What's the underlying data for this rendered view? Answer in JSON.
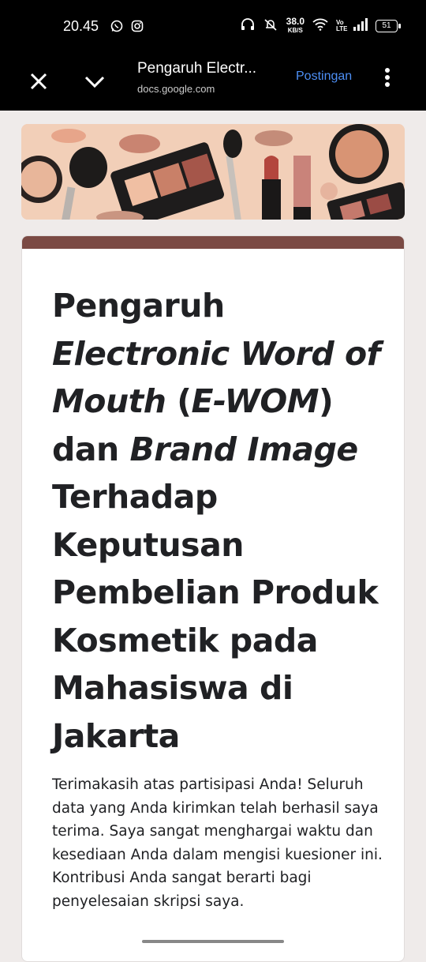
{
  "status": {
    "time": "20.45",
    "speed_value": "38.0",
    "speed_unit": "KB/S",
    "volte": "Vo LTE",
    "battery": "51",
    "icons": [
      "whatsapp-icon",
      "instagram-icon",
      "headphones-icon",
      "mute-icon",
      "wifi-icon",
      "signal-icon",
      "battery-icon"
    ]
  },
  "toolbar": {
    "title": "Pengaruh Electr...",
    "domain": "docs.google.com",
    "action_label": "Postingan",
    "accent_color": "#4d8ff5"
  },
  "form": {
    "theme_color": "#7b4a44",
    "title_parts": [
      {
        "text": "Pengaruh ",
        "italic": false
      },
      {
        "text": "Electronic Word of Mouth",
        "italic": true
      },
      {
        "text": " (",
        "italic": false
      },
      {
        "text": "E-WOM",
        "italic": true
      },
      {
        "text": ") dan ",
        "italic": false
      },
      {
        "text": "Brand Image",
        "italic": true
      },
      {
        "text": " Terhadap Keputusan Pembelian Produk Kosmetik pada Mahasiswa di Jakarta",
        "italic": false
      }
    ],
    "description": "Terimakasih atas partisipasi Anda! Seluruh data yang Anda kirimkan telah berhasil saya terima. Saya sangat menghargai waktu dan kesediaan Anda dalam mengisi kuesioner ini. Kontribusi Anda sangat berarti bagi penyelesaian skripsi saya."
  }
}
